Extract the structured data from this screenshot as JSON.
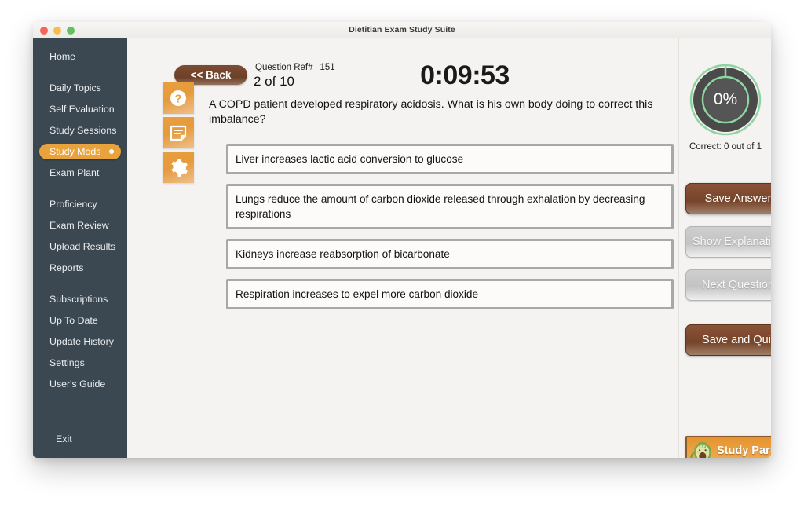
{
  "window": {
    "title": "Dietitian Exam Study Suite",
    "traffic_lights": [
      "close",
      "minimize",
      "maximize"
    ]
  },
  "sidebar": {
    "items": [
      {
        "label": "Home",
        "active": false,
        "gap_after": "lg"
      },
      {
        "label": "Daily Topics",
        "active": false,
        "gap_after": "sm"
      },
      {
        "label": "Self Evaluation",
        "active": false,
        "gap_after": "sm"
      },
      {
        "label": "Study Sessions",
        "active": false,
        "gap_after": "sm"
      },
      {
        "label": "Study Mods",
        "active": true,
        "gap_after": "sm"
      },
      {
        "label": "Exam Plant",
        "active": false,
        "gap_after": "lg"
      },
      {
        "label": "Proficiency",
        "active": false,
        "gap_after": "sm"
      },
      {
        "label": "Exam Review",
        "active": false,
        "gap_after": "sm"
      },
      {
        "label": "Upload Results",
        "active": false,
        "gap_after": "sm"
      },
      {
        "label": "Reports",
        "active": false,
        "gap_after": "lg"
      },
      {
        "label": "Subscriptions",
        "active": false,
        "gap_after": "sm"
      },
      {
        "label": "Up To Date",
        "active": false,
        "gap_after": "sm"
      },
      {
        "label": "Update History",
        "active": false,
        "gap_after": "sm"
      },
      {
        "label": "Settings",
        "active": false,
        "gap_after": "sm"
      },
      {
        "label": "User's Guide",
        "active": false,
        "gap_after": "sm"
      }
    ],
    "exit_label": "Exit",
    "active_color": "#e8a33d",
    "background_color": "#3b4852"
  },
  "toolbar": {
    "back_label": "<< Back",
    "rail_icons": [
      "help-icon",
      "notes-icon",
      "settings-gear-icon"
    ]
  },
  "question": {
    "ref_label": "Question Ref#",
    "ref_number": "151",
    "count_label": "2 of 10",
    "timer": "0:09:53",
    "text": "A COPD patient developed respiratory acidosis.  What is his own body doing to correct this imbalance?",
    "answers": [
      {
        "text": "Liver increases lactic acid conversion to glucose",
        "selected": false
      },
      {
        "text": "Lungs reduce the amount of carbon dioxide released through exhalation by decreasing respirations",
        "selected": false
      },
      {
        "text": "Kidneys increase reabsorption of bicarbonate",
        "selected": false
      },
      {
        "text": "Respiration increases to expel more carbon dioxide",
        "selected": false
      }
    ]
  },
  "score_panel": {
    "percent_label": "0%",
    "percent_value": 0,
    "caption": "Correct: 0 out of 1",
    "ring_color": "#8fd4a0",
    "dial_color": "#4a4a4a"
  },
  "actions": {
    "save_answer": "Save Answer",
    "show_explanation": "Show Explanation",
    "next_question": "Next Question",
    "save_and_quit": "Save and Quit"
  },
  "study_partner": {
    "label": "Study Partner",
    "mascot": "avocado-mascot-icon",
    "background_color": "#e5942f"
  }
}
